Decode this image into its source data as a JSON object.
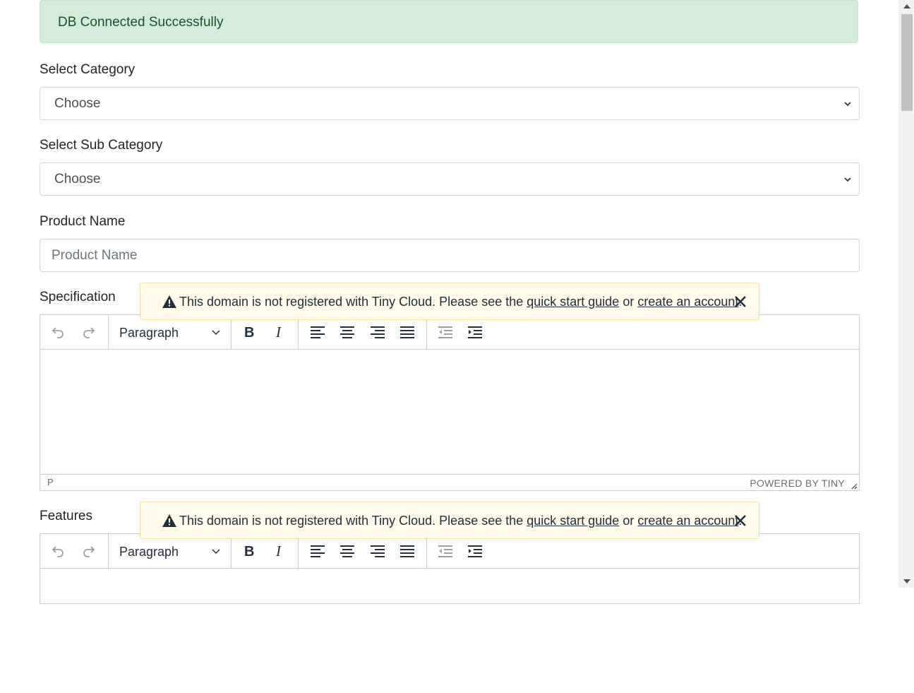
{
  "alert": {
    "text": "DB Connected Successfully"
  },
  "form": {
    "category": {
      "label": "Select Category",
      "value": "Choose"
    },
    "sub_category": {
      "label": "Select Sub Category",
      "value": "Choose"
    },
    "product_name": {
      "label": "Product Name",
      "placeholder": "Product Name"
    },
    "specification": {
      "label": "Specification"
    },
    "features": {
      "label": "Features"
    }
  },
  "editor": {
    "block_format": "Paragraph",
    "status_path": "P",
    "branding": "POWERED BY TINY"
  },
  "notice": {
    "text_before": "This domain is not registered with Tiny Cloud. Please see the ",
    "link1": "quick start guide",
    "text_mid": " or ",
    "link2": "create an account",
    "text_after": "."
  },
  "colors": {
    "alert_bg": "#d4edda",
    "alert_text": "#155724",
    "notice_bg": "#fffaea"
  }
}
